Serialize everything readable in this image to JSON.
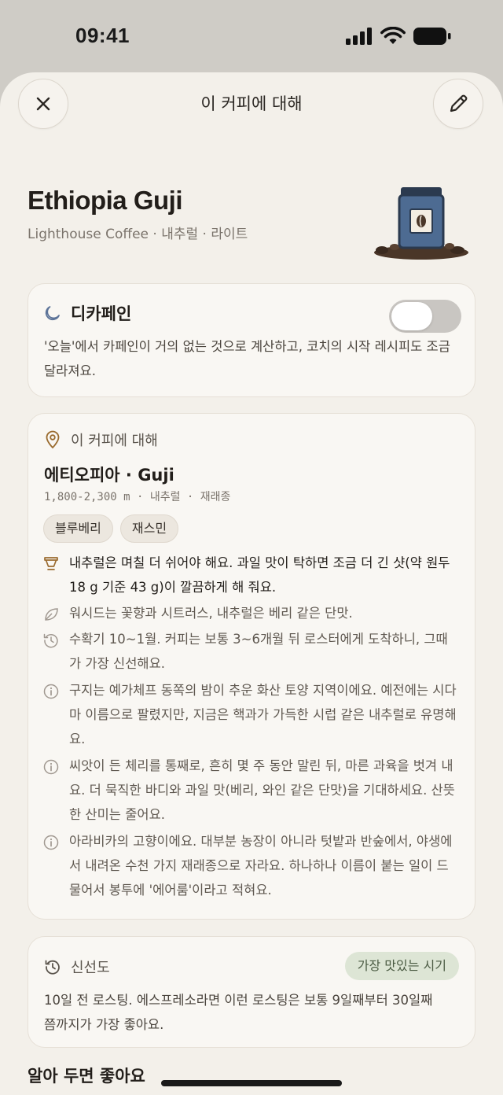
{
  "status_bar": {
    "time": "09:41"
  },
  "header": {
    "title": "이 커피에 대해"
  },
  "coffee": {
    "name": "Ethiopia Guji",
    "subtitle": "Lighthouse Coffee · 내추럴 · 라이트"
  },
  "decaf": {
    "title": "디카페인",
    "toggle_on": false,
    "description": "'오늘'에서 카페인이 거의 없는 것으로 계산하고, 코치의 시작 레시피도 조금 달라져요."
  },
  "about": {
    "section_label": "이 커피에 대해",
    "origin": "에티오피아 · Guji",
    "meta": "1,800-2,300 m · 내추럴 · 재래종",
    "notes": [
      "블루베리",
      "재스민"
    ],
    "items": [
      {
        "icon": "dripper-icon",
        "text": "내추럴은 며칠 더 쉬어야 해요. 과일 맛이 탁하면 조금 더 긴 샷(약 원두 18 g 기준 43 g)이 깔끔하게 해 줘요."
      },
      {
        "icon": "leaf-icon",
        "text": "워시드는 꽃향과 시트러스, 내추럴은 베리 같은 단맛."
      },
      {
        "icon": "history-icon",
        "text": "수확기 10~1월. 커피는 보통 3~6개월 뒤 로스터에게 도착하니, 그때가 가장 신선해요."
      },
      {
        "icon": "info-icon",
        "text": "구지는 예가체프 동쪽의 밤이 추운 화산 토양 지역이에요. 예전에는 시다마 이름으로 팔렸지만, 지금은 핵과가 가득한 시럽 같은 내추럴로 유명해요."
      },
      {
        "icon": "info-icon",
        "text": "씨앗이 든 체리를 통째로, 흔히 몇 주 동안 말린 뒤, 마른 과육을 벗겨 내요. 더 묵직한 바디와 과일 맛(베리, 와인 같은 단맛)을 기대하세요. 산뜻한 산미는 줄어요."
      },
      {
        "icon": "info-icon",
        "text": "아라비카의 고향이에요. 대부분 농장이 아니라 텃밭과 반숲에서, 야생에서 내려온 수천 가지 재래종으로 자라요. 하나하나 이름이 붙는 일이 드물어서 봉투에 '에어룸'이라고 적혀요."
      }
    ]
  },
  "freshness": {
    "title": "신선도",
    "badge": "가장 맛있는 시기",
    "description": "10일 전 로스팅. 에스프레소라면 이런 로스팅은 보통 9일째부터 30일째쯤까지가 가장 좋아요."
  },
  "tips": {
    "title": "알아 두면 좋아요"
  },
  "colors": {
    "sheet_bg": "#f3f0ea",
    "accent_brown": "#9a6b2f",
    "badge_green": "#dde5d5"
  }
}
